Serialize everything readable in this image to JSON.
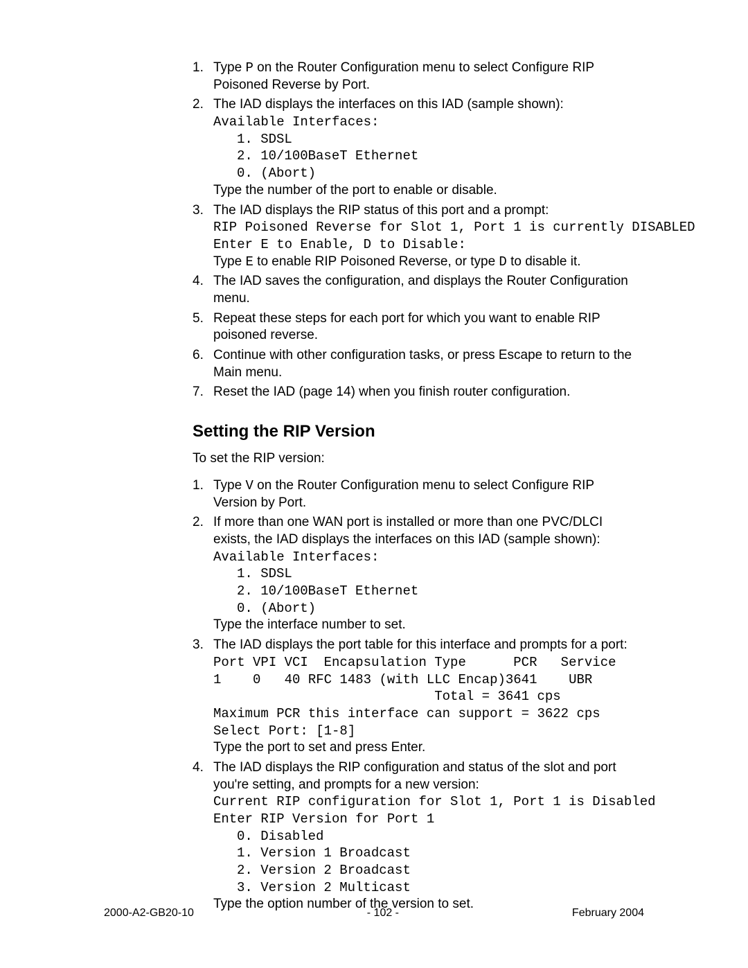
{
  "steps1": {
    "1": {
      "textA": "Type ",
      "code": "P",
      "textB": " on the Router Configuration menu to select Configure RIP Poisoned Reverse by Port."
    },
    "2": {
      "text": "The IAD displays the interfaces on this IAD (sample shown):",
      "code1": "Available Interfaces:",
      "code2": "1. SDSL",
      "code3": "2. 10/100BaseT Ethernet",
      "code4": "0. (Abort)",
      "after": "Type the number of the port to enable or disable."
    },
    "3": {
      "text": "The IAD displays the RIP status of this port and a prompt:",
      "code1": "RIP Poisoned Reverse for Slot 1, Port 1 is currently DISABLED",
      "code2": "Enter E to Enable, D to Disable:",
      "afterA": "Type ",
      "afterCode1": "E",
      "afterB": " to enable RIP Poisoned Reverse, or type ",
      "afterCode2": "D",
      "afterC": " to disable it."
    },
    "4": "The IAD saves the configuration, and displays the Router Configuration menu.",
    "5": "Repeat these steps for each port for which you want to enable RIP poisoned reverse.",
    "6": "Continue with other configuration tasks, or press Escape to return to the Main menu.",
    "7": "Reset the IAD (page 14) when you finish router configuration."
  },
  "section_heading": "Setting the RIP Version",
  "intro2": "To set the RIP version:",
  "steps2": {
    "1": {
      "textA": "Type ",
      "code": "V",
      "textB": " on the Router Configuration menu to select Configure RIP Version by Port."
    },
    "2": {
      "text": "If more than one WAN port is installed or more than one PVC/DLCI exists, the IAD displays the interfaces on this IAD (sample shown):",
      "code1": "Available Interfaces:",
      "code2": "1. SDSL",
      "code3": "2. 10/100BaseT Ethernet",
      "code4": "0. (Abort)",
      "after": "Type the interface number to set."
    },
    "3": {
      "text": "The IAD displays the port table for this interface and prompts for a port:",
      "code1": "Port VPI VCI  Encapsulation Type      PCR   Service",
      "code2": "1    0   40 RFC 1483 (with LLC Encap)3641    UBR",
      "code3": "                            Total = 3641 cps",
      "code4": "Maximum PCR this interface can support = 3622 cps",
      "code5": "Select Port: [1-8]",
      "after": "Type the port to set and press Enter."
    },
    "4": {
      "text": "The IAD displays the RIP configuration and status of the slot and port you're setting, and prompts for a new version:",
      "code1": "Current RIP configuration for Slot 1, Port 1 is Disabled",
      "code2": "Enter RIP Version for Port 1",
      "code3": "0. Disabled",
      "code4": "1. Version 1 Broadcast",
      "code5": "2. Version 2 Broadcast",
      "code6": "3. Version 2 Multicast",
      "after": "Type the option number of the version to set."
    }
  },
  "footer": {
    "left": "2000-A2-GB20-10",
    "center": "- 102 -",
    "right": "February 2004"
  }
}
